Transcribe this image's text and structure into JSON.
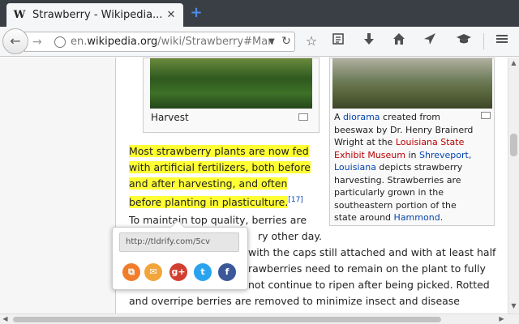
{
  "tab": {
    "favicon": "W",
    "title": "Strawberry - Wikipedia...",
    "close_label": "✕",
    "new_tab_label": "+"
  },
  "navbar": {
    "back_label": "←",
    "forward_label": "→",
    "url_prefix": "en.",
    "url_domain": "wikipedia.org",
    "url_path": "/wiki/Strawberry#Manu",
    "icons": [
      "star-icon",
      "reading-list-icon",
      "download-icon",
      "home-icon",
      "send-icon",
      "graduation-cap-icon",
      "menu-icon"
    ]
  },
  "figures": {
    "harvest_caption": "Harvest",
    "diorama": {
      "t1": "A ",
      "l1": "diorama",
      "t2": " created from beeswax by Dr. Henry Brainerd Wright at the ",
      "l2": "Louisiana State Exhibit Museum",
      "t3": " in ",
      "l3": "Shreveport, Louisiana",
      "t4": " depicts strawberry harvesting. Strawberries are particularly grown in the southeastern portion of the state around ",
      "l4": "Hammond",
      "t5": "."
    }
  },
  "article": {
    "hl1": "Most strawberry plants are now fed",
    "hl2": "with artificial fertilizers, both before",
    "hl3": "and after harvesting, and often",
    "hl4": "before planting in plasticulture.",
    "cite": "[17]",
    "p1": "To maintain top quality, berries are",
    "p2": "ry other day.",
    "p3": "with the caps still attached and with at least half",
    "p4": "rawberries need to remain on the plant to fully",
    "p5": "not continue to ripen after being picked. Rotted",
    "p6": "and overripe berries are removed to minimize insect and disease"
  },
  "share_popup": {
    "link": "http://tldrify.com/5cv",
    "buttons": [
      {
        "name": "copy",
        "glyph": "⧉",
        "color": "#f07d2c"
      },
      {
        "name": "email",
        "glyph": "✉",
        "color": "#f2a53a"
      },
      {
        "name": "google-plus",
        "glyph": "g+",
        "color": "#d23f31"
      },
      {
        "name": "twitter",
        "glyph": "t",
        "color": "#2aa3ef"
      },
      {
        "name": "facebook",
        "glyph": "f",
        "color": "#3b5998"
      }
    ]
  }
}
